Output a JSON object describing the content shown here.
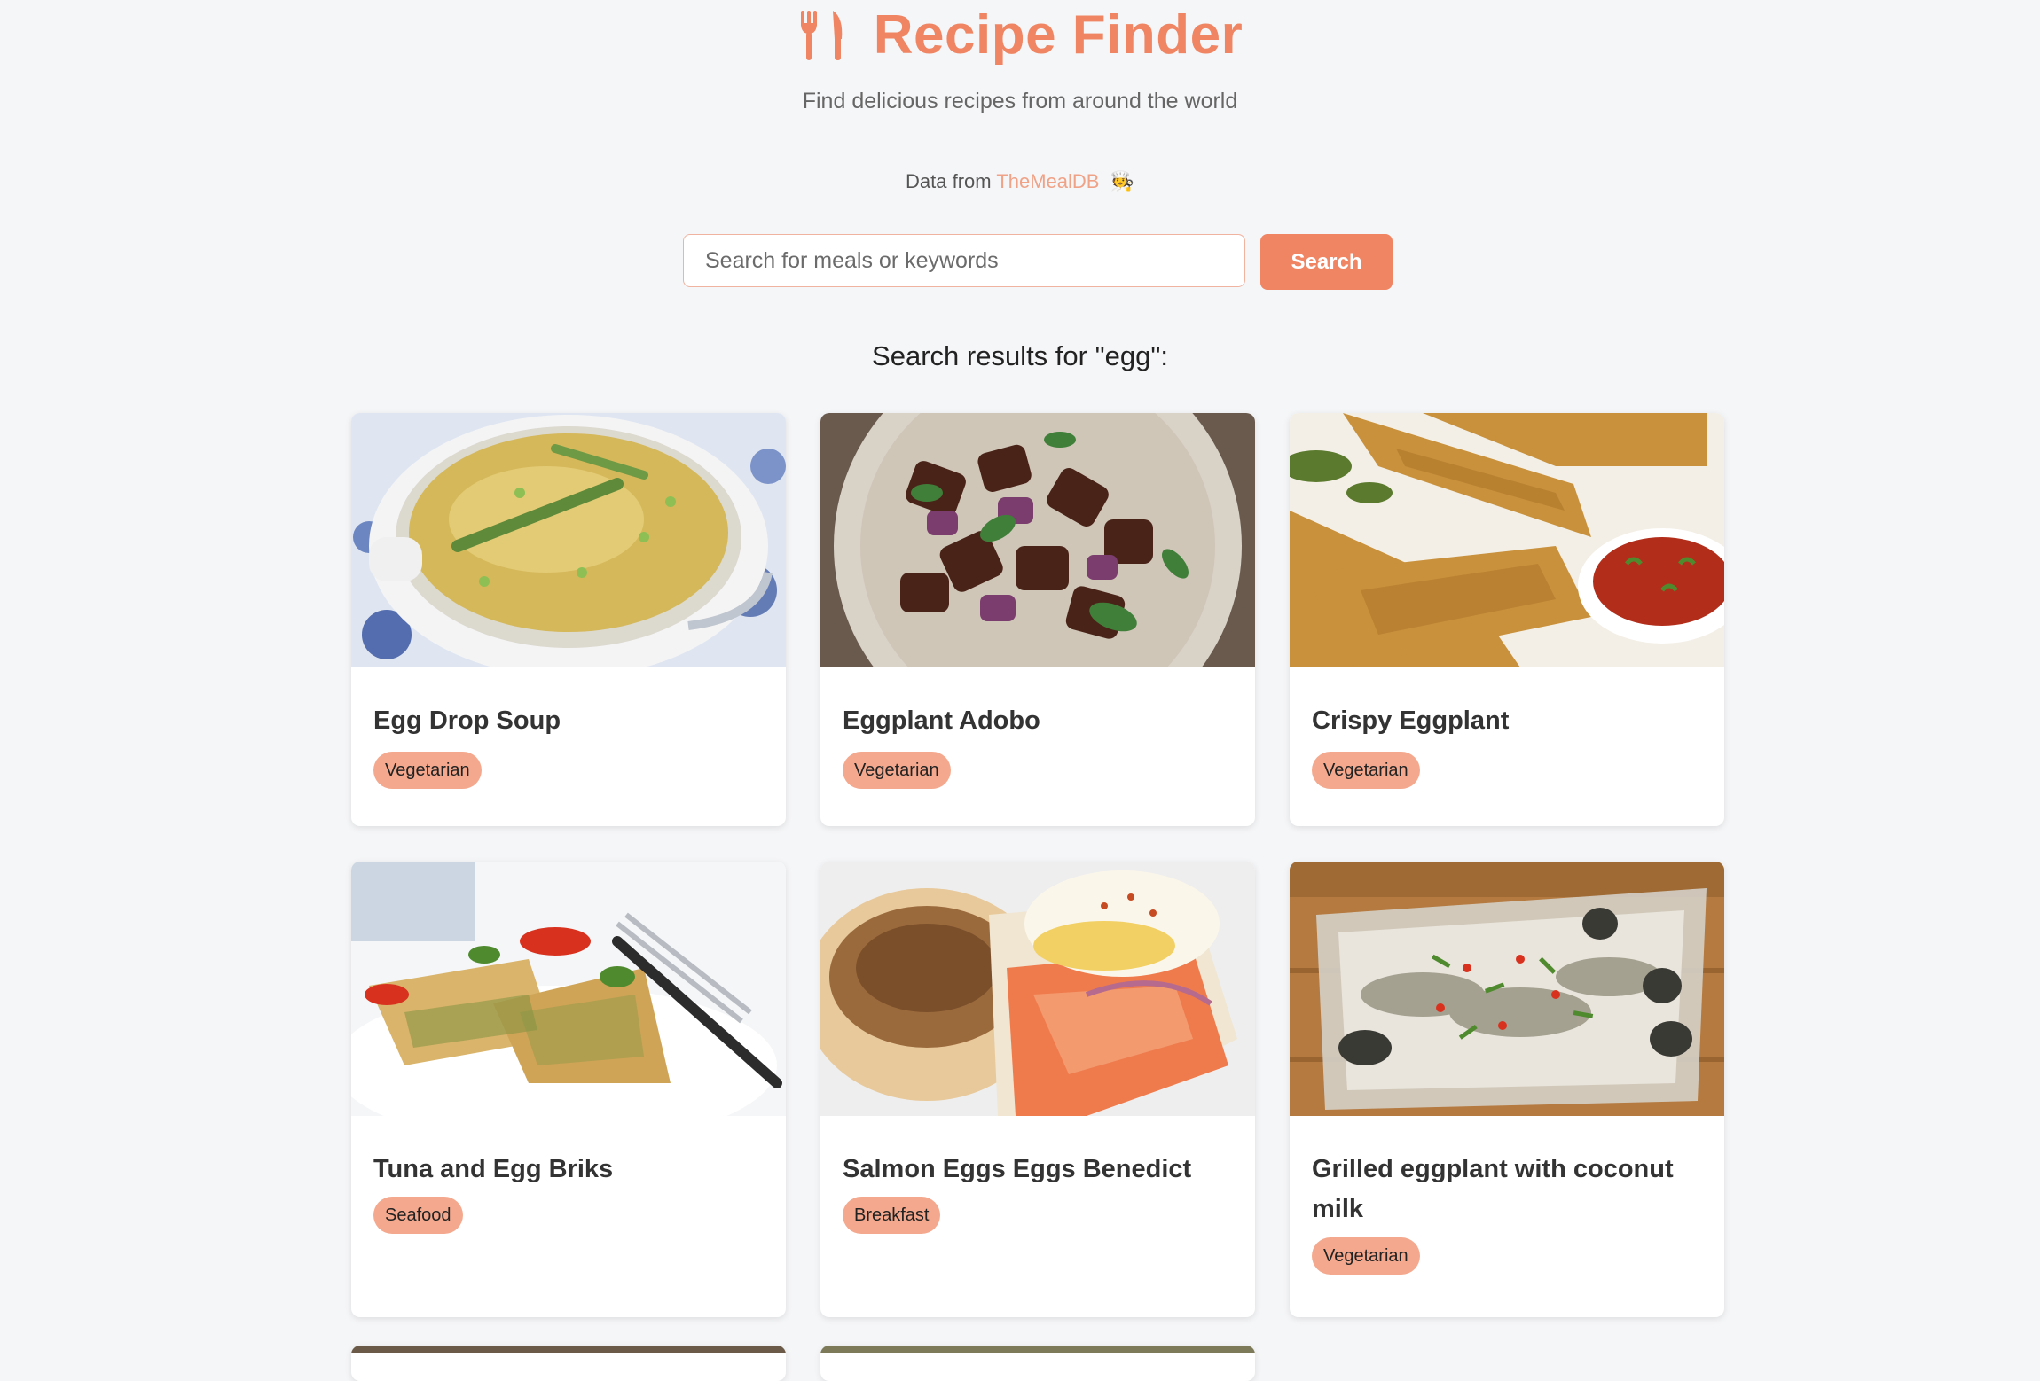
{
  "header": {
    "title": "Recipe Finder",
    "title_icon": "fork-knife-icon",
    "subtitle": "Find delicious recipes from around the world",
    "credit_prefix": "Data from",
    "credit_link": "TheMealDB",
    "credit_emoji": "🧑‍🍳"
  },
  "search": {
    "placeholder": "Search for meals or keywords",
    "value": "",
    "button_label": "Search"
  },
  "results": {
    "heading": "Search results for \"egg\":",
    "items": [
      {
        "title": "Egg Drop Soup",
        "tag": "Vegetarian"
      },
      {
        "title": "Eggplant Adobo",
        "tag": "Vegetarian"
      },
      {
        "title": "Crispy Eggplant",
        "tag": "Vegetarian"
      },
      {
        "title": "Tuna and Egg Briks",
        "tag": "Seafood"
      },
      {
        "title": "Salmon Eggs Eggs Benedict",
        "tag": "Breakfast"
      },
      {
        "title": "Grilled eggplant with coconut milk",
        "tag": "Vegetarian"
      }
    ]
  },
  "colors": {
    "accent": "#ef8563",
    "tag_bg": "#f4a98e",
    "background": "#f5f6f8"
  }
}
